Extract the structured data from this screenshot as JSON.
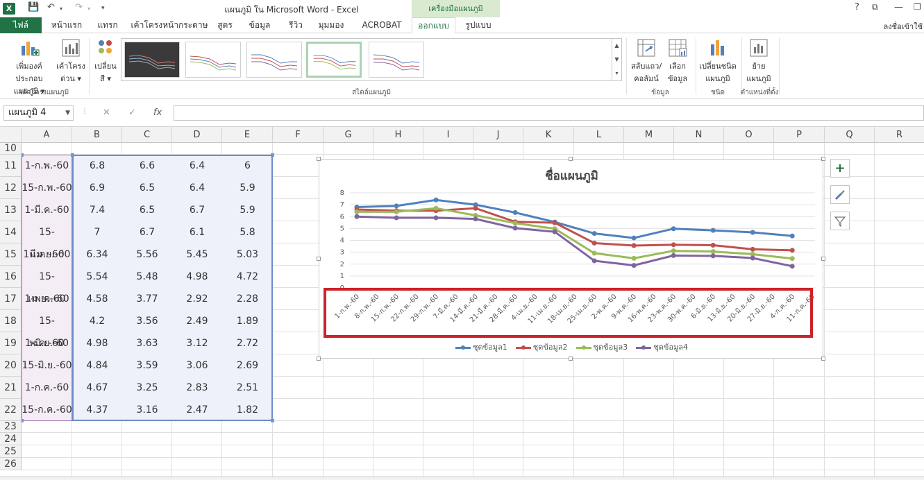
{
  "window": {
    "title": "แผนภูมิ ใน Microsoft Word - Excel",
    "contextual_tab_group": "เครื่องมือแผนภูมิ",
    "help": "?",
    "signin": "ลงชื่อเข้าใช้"
  },
  "tabs": [
    {
      "label": "ไฟล์"
    },
    {
      "label": "หน้าแรก"
    },
    {
      "label": "แทรก"
    },
    {
      "label": "เค้าโครงหน้ากระดาษ"
    },
    {
      "label": "สูตร"
    },
    {
      "label": "ข้อมูล"
    },
    {
      "label": "รีวิว"
    },
    {
      "label": "มุมมอง"
    },
    {
      "label": "ACROBAT"
    },
    {
      "label": "ออกแบบ"
    },
    {
      "label": "รูปแบบ"
    }
  ],
  "ribbon": {
    "add_element_1": "เพิ่มองค์ประกอบ",
    "add_element_2": "แผนภูมิ ▾",
    "quick_layout_1": "เค้าโครง",
    "quick_layout_2": "ด่วน ▾",
    "change_colors_1": "เปลี่ยน",
    "change_colors_2": "สี ▾",
    "group_layouts": "เค้าโครงแผนภูมิ",
    "group_styles": "สไตล์แผนภูมิ",
    "switch_1": "สลับแถว/",
    "switch_2": "คอลัมน์",
    "select_data_1": "เลือก",
    "select_data_2": "ข้อมูล",
    "group_data": "ข้อมูล",
    "change_type_1": "เปลี่ยนชนิด",
    "change_type_2": "แผนภูมิ",
    "group_type": "ชนิด",
    "move_1": "ย้าย",
    "move_2": "แผนภูมิ",
    "group_location": "ตำแหน่งที่ตั้ง"
  },
  "formula_bar": {
    "name_box": "แผนภูมิ 4",
    "fx": "fx",
    "value": ""
  },
  "columns": [
    "A",
    "B",
    "C",
    "D",
    "E",
    "F",
    "G",
    "H",
    "I",
    "J",
    "K",
    "L",
    "M",
    "N",
    "O",
    "P",
    "Q",
    "R"
  ],
  "rows": [
    {
      "num": "10",
      "cells": [
        "",
        "",
        "",
        "",
        ""
      ]
    },
    {
      "num": "11",
      "cells": [
        "1-ก.พ.-60",
        "6.8",
        "6.6",
        "6.4",
        "6"
      ]
    },
    {
      "num": "12",
      "cells": [
        "15-ก.พ.-60",
        "6.9",
        "6.5",
        "6.4",
        "5.9"
      ]
    },
    {
      "num": "13",
      "cells": [
        "1-มี.ค.-60",
        "7.4",
        "6.5",
        "6.7",
        "5.9"
      ]
    },
    {
      "num": "14",
      "cells": [
        "15-มี.ค.-60",
        "7",
        "6.7",
        "6.1",
        "5.8"
      ]
    },
    {
      "num": "15",
      "cells": [
        "1-เม.ย.-60",
        "6.34",
        "5.56",
        "5.45",
        "5.03"
      ]
    },
    {
      "num": "16",
      "cells": [
        "15-เม.ย.-60",
        "5.54",
        "5.48",
        "4.98",
        "4.72"
      ]
    },
    {
      "num": "17",
      "cells": [
        "1-พ.ค.-60",
        "4.58",
        "3.77",
        "2.92",
        "2.28"
      ]
    },
    {
      "num": "18",
      "cells": [
        "15-พ.ค.-60",
        "4.2",
        "3.56",
        "2.49",
        "1.89"
      ]
    },
    {
      "num": "19",
      "cells": [
        "1-มิ.ย.-60",
        "4.98",
        "3.63",
        "3.12",
        "2.72"
      ]
    },
    {
      "num": "20",
      "cells": [
        "15-มิ.ย.-60",
        "4.84",
        "3.59",
        "3.06",
        "2.69"
      ]
    },
    {
      "num": "21",
      "cells": [
        "1-ก.ค.-60",
        "4.67",
        "3.25",
        "2.83",
        "2.51"
      ]
    },
    {
      "num": "22",
      "cells": [
        "15-ก.ค.-60",
        "4.37",
        "3.16",
        "2.47",
        "1.82"
      ]
    },
    {
      "num": "23",
      "cells": [
        "",
        "",
        "",
        "",
        ""
      ]
    },
    {
      "num": "24",
      "cells": [
        "",
        "",
        "",
        "",
        ""
      ]
    },
    {
      "num": "25",
      "cells": [
        "",
        "",
        "",
        "",
        ""
      ]
    },
    {
      "num": "26",
      "cells": [
        "",
        "",
        "",
        "",
        ""
      ]
    }
  ],
  "chart_data": {
    "type": "line",
    "title": "ชื่อแผนภูมิ",
    "ylim": [
      0,
      8
    ],
    "yticks": [
      "0",
      "1",
      "2",
      "3",
      "4",
      "5",
      "6",
      "7",
      "8"
    ],
    "categories": [
      "1-ก.พ.-60",
      "8-ก.พ.-60",
      "15-ก.พ.-60",
      "22-ก.พ.-60",
      "29-ก.พ.-60",
      "7-มี.ค.-60",
      "14-มี.ค.-60",
      "21-มี.ค.-60",
      "28-มี.ค.-60",
      "4-เม.ย.-60",
      "11-เม.ย.-60",
      "18-เม.ย.-60",
      "25-เม.ย.-60",
      "2-พ.ค.-60",
      "9-พ.ค.-60",
      "16-พ.ค.-60",
      "23-พ.ค.-60",
      "30-พ.ค.-60",
      "6-มิ.ย.-60",
      "13-มิ.ย.-60",
      "20-มิ.ย.-60",
      "27-มิ.ย.-60",
      "4-ก.ค.-60",
      "11-ก.ค.-60"
    ],
    "x_points": [
      0,
      2,
      4,
      6,
      8,
      10,
      12,
      14,
      16,
      18,
      20,
      22
    ],
    "series": [
      {
        "name": "ชุดข้อมูล1",
        "color": "#4f81bd",
        "values": [
          6.8,
          6.9,
          7.4,
          7,
          6.34,
          5.54,
          4.58,
          4.2,
          4.98,
          4.84,
          4.67,
          4.37
        ]
      },
      {
        "name": "ชุดข้อมูล2",
        "color": "#c0504d",
        "values": [
          6.6,
          6.5,
          6.5,
          6.7,
          5.56,
          5.48,
          3.77,
          3.56,
          3.63,
          3.59,
          3.25,
          3.16
        ]
      },
      {
        "name": "ชุดข้อมูล3",
        "color": "#9bbb59",
        "values": [
          6.4,
          6.4,
          6.7,
          6.1,
          5.45,
          4.98,
          2.92,
          2.49,
          3.12,
          3.06,
          2.83,
          2.47
        ]
      },
      {
        "name": "ชุดข้อมูล4",
        "color": "#8064a2",
        "values": [
          6,
          5.9,
          5.9,
          5.8,
          5.03,
          4.72,
          2.28,
          1.89,
          2.72,
          2.69,
          2.51,
          1.82
        ]
      }
    ],
    "legend": "bottom",
    "grid": true,
    "highlight_color": "#cc2229"
  },
  "chart_tools": {
    "add_icon": "plus-icon",
    "style_icon": "brush-icon",
    "filter_icon": "filter-icon"
  }
}
